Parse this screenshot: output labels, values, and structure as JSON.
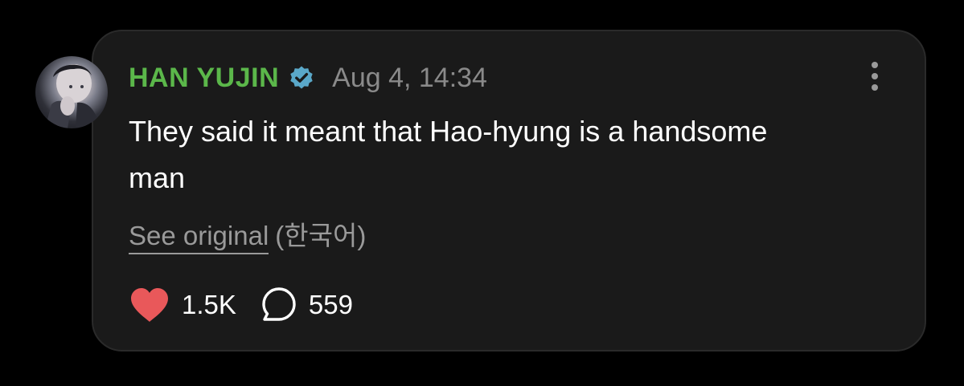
{
  "comment": {
    "author": "HAN YUJIN",
    "timestamp": "Aug 4, 14:34",
    "text": "They said it meant that Hao-hyung is a handsome man",
    "see_original_label": "See original",
    "original_language": "(한국어)",
    "likes": "1.5K",
    "replies": "559",
    "verified_icon": "verified-badge-icon",
    "more_icon": "more-vertical-icon"
  },
  "colors": {
    "author": "#5bb74a",
    "verified": "#5aa8c9",
    "heart": "#e9585a",
    "card_bg": "#1a1a1a",
    "page_bg": "#000000"
  }
}
